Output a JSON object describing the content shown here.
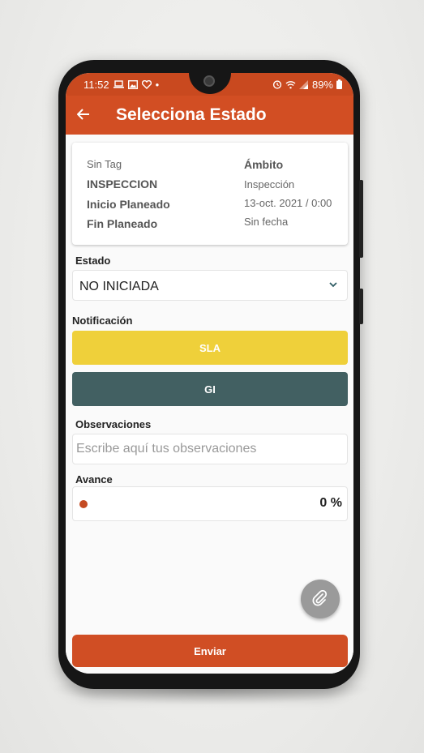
{
  "statusbar": {
    "time": "11:52",
    "dot": "•",
    "battery": "89%"
  },
  "appbar": {
    "back_icon": "arrow-left-icon",
    "title": "Selecciona Estado"
  },
  "card": {
    "tag": "Sin Tag",
    "ambito_label": "Ámbito",
    "type_label": "INSPECCION",
    "type_value": "Inspección",
    "inicio_label": "Inicio Planeado",
    "inicio_value": "13-oct. 2021 / 0:00",
    "fin_label": "Fin Planeado",
    "fin_value": "Sin fecha"
  },
  "estado": {
    "label": "Estado",
    "value": "NO INICIADA"
  },
  "notificacion": {
    "label": "Notificación",
    "buttons": [
      {
        "label": "SLA",
        "bg": "#efd03a",
        "fg": "#ffffff"
      },
      {
        "label": "GI",
        "bg": "#426062",
        "fg": "#ffffff"
      }
    ]
  },
  "observaciones": {
    "label": "Observaciones",
    "placeholder": "Escribe aquí tus observaciones"
  },
  "avance": {
    "label": "Avance",
    "value": 0,
    "display": "0 %"
  },
  "fab_icon": "paperclip-icon",
  "submit": {
    "label": "Enviar"
  },
  "colors": {
    "accent": "#d24e23",
    "status_bar": "#c9491f"
  }
}
